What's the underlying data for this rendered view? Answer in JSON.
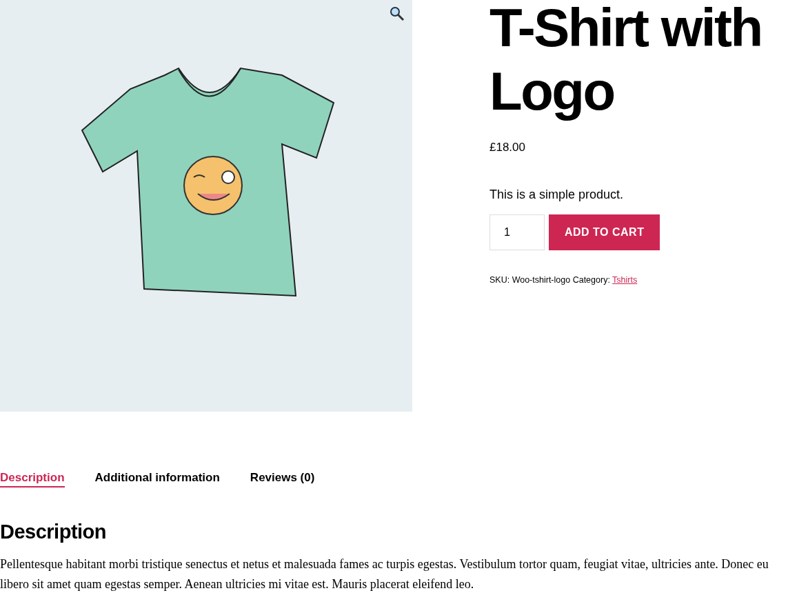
{
  "product": {
    "title": "T-Shirt with Logo",
    "price": "£18.00",
    "short_description": "This is a simple product.",
    "quantity": "1",
    "add_to_cart": "ADD TO CART",
    "sku": "SKU: Woo-tshirt-logo",
    "category_label": "Category:",
    "category": "Tshirts"
  },
  "tabs": [
    {
      "label": "Description",
      "selected": true
    },
    {
      "label": "Additional information",
      "selected": false
    },
    {
      "label": "Reviews (0)",
      "selected": false
    }
  ],
  "panel": {
    "heading": "Description",
    "text": "Pellentesque habitant morbi tristique senectus et netus et malesuada fames ac turpis egestas. Vestibulum tortor quam, feugiat vitae, ultricies ante. Donec eu libero sit amet quam egestas semper. Aenean ultricies mi vitae est. Mauris placerat eleifend leo."
  }
}
